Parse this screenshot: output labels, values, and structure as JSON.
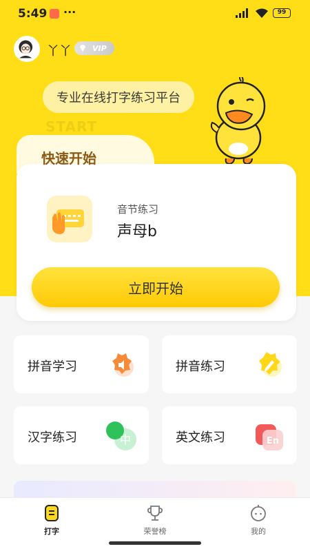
{
  "status_bar": {
    "time": "5:49",
    "dots": "···",
    "battery": "99"
  },
  "profile": {
    "username": "丫丫",
    "vip_label": "VIP"
  },
  "slogan": "专业在线打字练习平台",
  "quick_start": {
    "watermark": "START",
    "title": "快速开始",
    "subtitle": "音节练习",
    "lesson": "声母b",
    "start_label": "立即开始"
  },
  "features": [
    {
      "label": "拼音学习",
      "icon": "speaker-icon",
      "color": "#f58a3a"
    },
    {
      "label": "拼音练习",
      "icon": "pencil-icon",
      "color": "#ffd81a"
    },
    {
      "label": "汉字练习",
      "icon": "chinese-char-icon",
      "color": "#2fc25b",
      "icon_text": "中"
    },
    {
      "label": "英文练习",
      "icon": "english-icon",
      "color": "#f25a5a",
      "icon_text": "En"
    }
  ],
  "bottom_nav": [
    {
      "label": "打字",
      "icon": "keyboard-tab-icon",
      "active": true
    },
    {
      "label": "荣誉榜",
      "icon": "trophy-icon",
      "active": false
    },
    {
      "label": "我的",
      "icon": "profile-face-icon",
      "active": false
    }
  ],
  "colors": {
    "brand_yellow": "#ffde17",
    "button_yellow": "#ffca05",
    "title_brown": "#8a5a16"
  }
}
